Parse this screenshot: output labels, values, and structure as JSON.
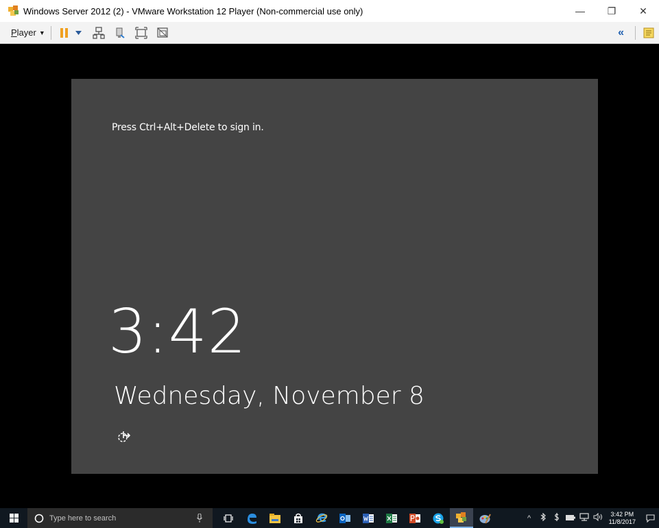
{
  "window": {
    "title": "Windows Server 2012 (2) - VMware Workstation 12 Player (Non-commercial use only)",
    "minimize": "—",
    "restore": "❐",
    "close": "✕"
  },
  "toolbar": {
    "player_label_first": "P",
    "player_label_rest": "layer",
    "dropdown": "▼",
    "right_arrow": "«"
  },
  "lockscreen": {
    "prompt": "Press Ctrl+Alt+Delete to sign in.",
    "time": "3:42",
    "date": "Wednesday, November 8"
  },
  "taskbar": {
    "search_placeholder": "Type here to search",
    "tray_time": "3:42 PM",
    "tray_date": "11/8/2017",
    "tray_chevron": "^"
  },
  "colors": {
    "lockscreen_bg": "#444444",
    "taskbar_bg": "#101820",
    "pause_orange": "#f0a020"
  }
}
